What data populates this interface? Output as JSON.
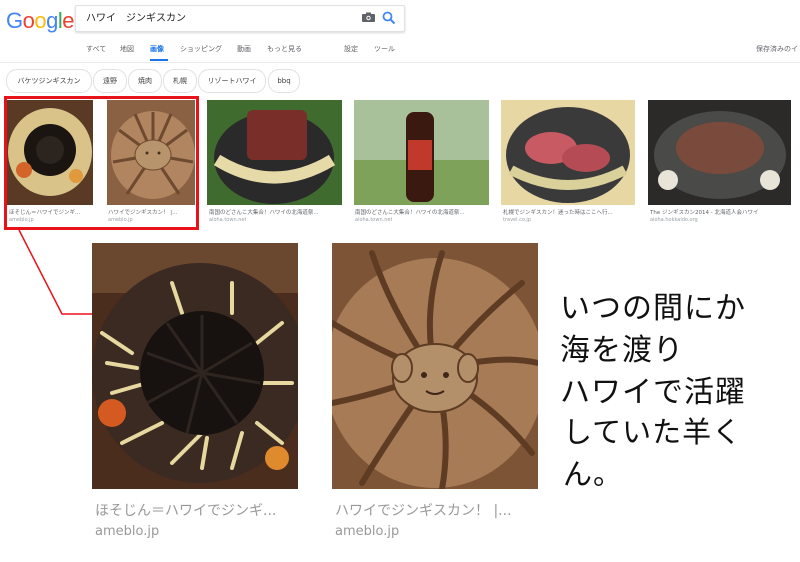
{
  "search": {
    "query": "ハワイ　ジンギスカン"
  },
  "logo": [
    "G",
    "o",
    "o",
    "g",
    "l",
    "e"
  ],
  "colors": {
    "blue": "#4285f4",
    "red": "#ea4335",
    "yellow": "#fbbc05",
    "green": "#34a853",
    "highlight": "#e8121a",
    "active_tab": "#1a73e8"
  },
  "tabs": [
    "すべて",
    "地図",
    "画像",
    "ショッピング",
    "動画",
    "もっと見る",
    "設定",
    "ツール"
  ],
  "active_tab": "画像",
  "safe_search": "保存済みのイ",
  "chips": [
    "バケツジンギスカン",
    "遠野",
    "焼肉",
    "札幌",
    "リゾートハワイ",
    "bbq"
  ],
  "results": [
    {
      "title": "ほそじん＝ハワイでジンギ...",
      "source": "ameblo.jp"
    },
    {
      "title": "ハワイでジンギスカン！ |...",
      "source": "ameblo.jp"
    },
    {
      "title": "南国のどさんこ大集合！ハワイの北海道祭...",
      "source": "aloha.town.net"
    },
    {
      "title": "南国のどさんこ大集合！ハワイの北海道祭...",
      "source": "aloha.town.net"
    },
    {
      "title": "札幌でジンギスカン！迷った時はここへ行...",
      "source": "travel.co.jp"
    },
    {
      "title": "The ジンギスカン2014 - 北海道人会ハワイ",
      "source": "aloha.hokkaido.org"
    }
  ],
  "enlarged": [
    {
      "title": "ほそじん＝ハワイでジンギ...",
      "source": "ameblo.jp"
    },
    {
      "title": "ハワイでジンギスカン！ |...",
      "source": "ameblo.jp"
    }
  ],
  "annotation": [
    "いつの間にか",
    "海を渡り",
    "ハワイで活躍",
    "していた羊くん。"
  ]
}
